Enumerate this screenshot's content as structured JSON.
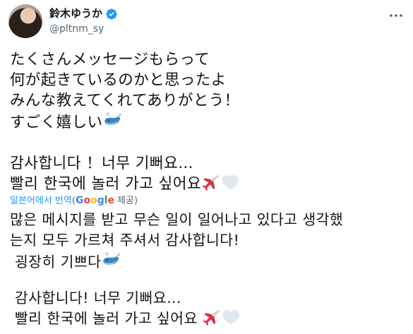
{
  "user": {
    "display_name": "鈴木ゆうか",
    "handle": "@pltnm_sy"
  },
  "tweet": {
    "original_lines": [
      "たくさんメッセージもらって",
      "何が起きているのかと思ったよ",
      "みんな教えてくれてありがとう！",
      "すごく嬉しい"
    ],
    "korean_lines": [
      "감사합니다 ！너무 기뻐요…",
      "빨리 한국에 놀러 가고 싶어요"
    ]
  },
  "translation": {
    "link_label": "일본어에서 번역",
    "provider_word": "Google",
    "provider_suffix": "제공",
    "lines": [
      "많은 메시지를 받고 무슨 일이 일어나고 있다고 생각했",
      "는지 모두 가르쳐 주셔서 감사합니다!",
      " 굉장히 기쁘다",
      " 감사합니다! 너무 기뻐요…",
      " 빨리 한국에 놀러 가고 싶어요"
    ]
  },
  "colors": {
    "link": "#1d9bf0",
    "secondary_text": "#536471",
    "verified": "#1d9bf0"
  },
  "icons": [
    "verified-badge-icon",
    "more-options-icon",
    "whale-emoji-icon",
    "airplane-emoji-icon",
    "white-heart-emoji-icon"
  ]
}
